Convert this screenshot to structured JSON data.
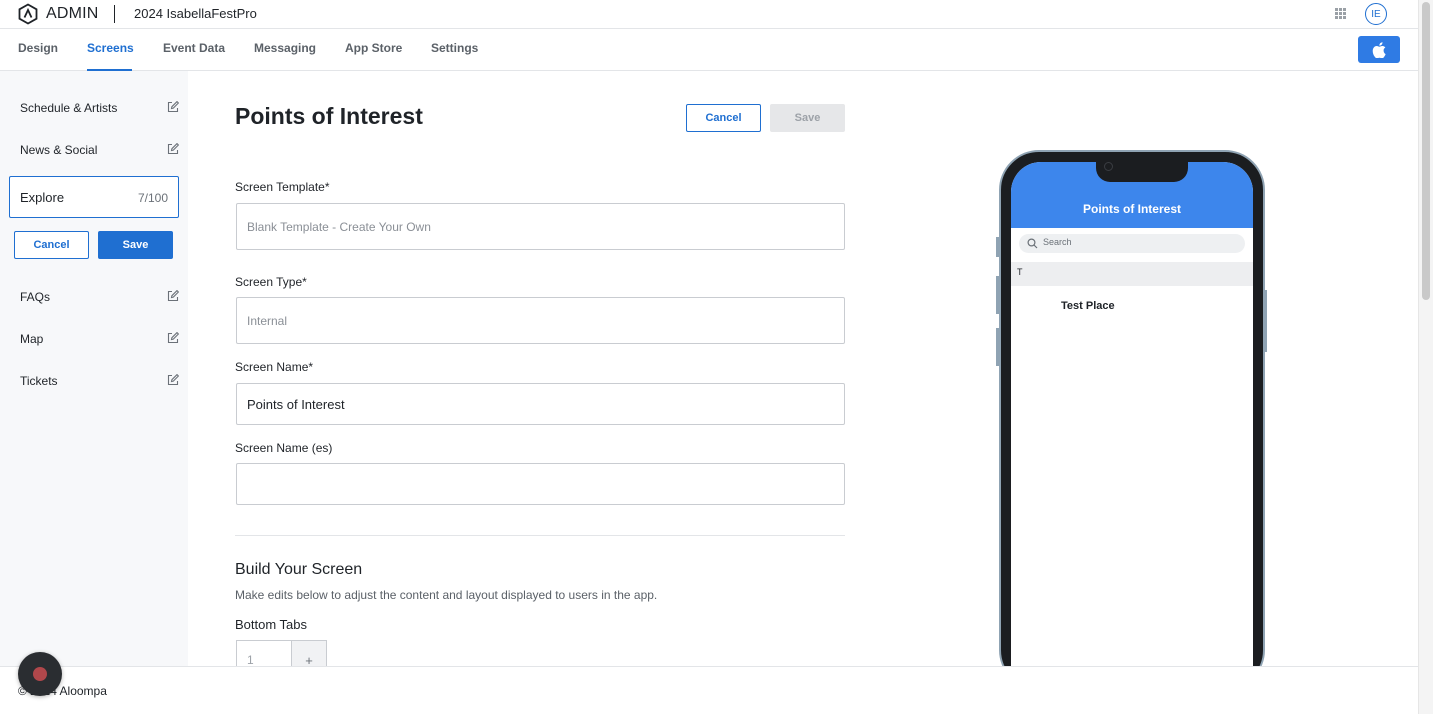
{
  "app": {
    "brand": "ADMIN",
    "project": "2024 IsabellaFestPro",
    "user_initials": "IE",
    "logo_icon": "hexagon-a-logo",
    "apps_icon": "grid-icon",
    "accent_color": "#1f6fd1"
  },
  "nav": {
    "tabs": [
      {
        "label": "Design"
      },
      {
        "label": "Screens"
      },
      {
        "label": "Event Data"
      },
      {
        "label": "Messaging"
      },
      {
        "label": "App Store"
      },
      {
        "label": "Settings"
      }
    ],
    "active": "Screens",
    "platform_icon": "apple-icon"
  },
  "sidebar": {
    "items": [
      {
        "label": "Schedule & Artists"
      },
      {
        "label": "News & Social"
      },
      {
        "label": "FAQs"
      },
      {
        "label": "Map"
      },
      {
        "label": "Tickets"
      }
    ],
    "editing": {
      "value": "Explore",
      "count": "7/100",
      "cancel_label": "Cancel",
      "save_label": "Save"
    }
  },
  "form": {
    "title": "Points of Interest",
    "cancel_label": "Cancel",
    "save_label": "Save",
    "template_label": "Screen Template*",
    "template_value": "Blank Template - Create Your Own",
    "type_label": "Screen Type*",
    "type_value": "Internal",
    "name_label": "Screen Name*",
    "name_value": "Points of Interest",
    "name_es_label": "Screen Name (es)",
    "name_es_value": "",
    "build_title": "Build Your Screen",
    "build_desc": "Make edits below to adjust the content and layout displayed to users in the app.",
    "bottom_tabs_label": "Bottom Tabs",
    "bottom_tabs_value": "1",
    "plus_label": "+"
  },
  "preview": {
    "header_title": "Points of Interest",
    "search_placeholder": "Search",
    "section_letter": "T",
    "items": [
      "Test Place"
    ],
    "header_color": "#3d86ec"
  },
  "footer": {
    "copyright": "© 2024 Aloompa"
  }
}
